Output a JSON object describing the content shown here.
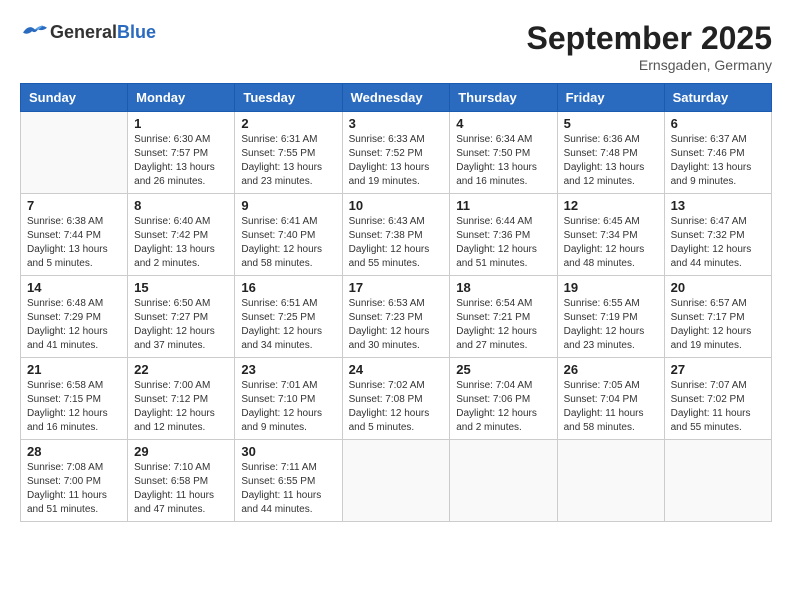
{
  "header": {
    "logo_general": "General",
    "logo_blue": "Blue",
    "month_title": "September 2025",
    "location": "Ernsgaden, Germany"
  },
  "weekdays": [
    "Sunday",
    "Monday",
    "Tuesday",
    "Wednesday",
    "Thursday",
    "Friday",
    "Saturday"
  ],
  "weeks": [
    [
      {
        "day": "",
        "info": ""
      },
      {
        "day": "1",
        "info": "Sunrise: 6:30 AM\nSunset: 7:57 PM\nDaylight: 13 hours\nand 26 minutes."
      },
      {
        "day": "2",
        "info": "Sunrise: 6:31 AM\nSunset: 7:55 PM\nDaylight: 13 hours\nand 23 minutes."
      },
      {
        "day": "3",
        "info": "Sunrise: 6:33 AM\nSunset: 7:52 PM\nDaylight: 13 hours\nand 19 minutes."
      },
      {
        "day": "4",
        "info": "Sunrise: 6:34 AM\nSunset: 7:50 PM\nDaylight: 13 hours\nand 16 minutes."
      },
      {
        "day": "5",
        "info": "Sunrise: 6:36 AM\nSunset: 7:48 PM\nDaylight: 13 hours\nand 12 minutes."
      },
      {
        "day": "6",
        "info": "Sunrise: 6:37 AM\nSunset: 7:46 PM\nDaylight: 13 hours\nand 9 minutes."
      }
    ],
    [
      {
        "day": "7",
        "info": "Sunrise: 6:38 AM\nSunset: 7:44 PM\nDaylight: 13 hours\nand 5 minutes."
      },
      {
        "day": "8",
        "info": "Sunrise: 6:40 AM\nSunset: 7:42 PM\nDaylight: 13 hours\nand 2 minutes."
      },
      {
        "day": "9",
        "info": "Sunrise: 6:41 AM\nSunset: 7:40 PM\nDaylight: 12 hours\nand 58 minutes."
      },
      {
        "day": "10",
        "info": "Sunrise: 6:43 AM\nSunset: 7:38 PM\nDaylight: 12 hours\nand 55 minutes."
      },
      {
        "day": "11",
        "info": "Sunrise: 6:44 AM\nSunset: 7:36 PM\nDaylight: 12 hours\nand 51 minutes."
      },
      {
        "day": "12",
        "info": "Sunrise: 6:45 AM\nSunset: 7:34 PM\nDaylight: 12 hours\nand 48 minutes."
      },
      {
        "day": "13",
        "info": "Sunrise: 6:47 AM\nSunset: 7:32 PM\nDaylight: 12 hours\nand 44 minutes."
      }
    ],
    [
      {
        "day": "14",
        "info": "Sunrise: 6:48 AM\nSunset: 7:29 PM\nDaylight: 12 hours\nand 41 minutes."
      },
      {
        "day": "15",
        "info": "Sunrise: 6:50 AM\nSunset: 7:27 PM\nDaylight: 12 hours\nand 37 minutes."
      },
      {
        "day": "16",
        "info": "Sunrise: 6:51 AM\nSunset: 7:25 PM\nDaylight: 12 hours\nand 34 minutes."
      },
      {
        "day": "17",
        "info": "Sunrise: 6:53 AM\nSunset: 7:23 PM\nDaylight: 12 hours\nand 30 minutes."
      },
      {
        "day": "18",
        "info": "Sunrise: 6:54 AM\nSunset: 7:21 PM\nDaylight: 12 hours\nand 27 minutes."
      },
      {
        "day": "19",
        "info": "Sunrise: 6:55 AM\nSunset: 7:19 PM\nDaylight: 12 hours\nand 23 minutes."
      },
      {
        "day": "20",
        "info": "Sunrise: 6:57 AM\nSunset: 7:17 PM\nDaylight: 12 hours\nand 19 minutes."
      }
    ],
    [
      {
        "day": "21",
        "info": "Sunrise: 6:58 AM\nSunset: 7:15 PM\nDaylight: 12 hours\nand 16 minutes."
      },
      {
        "day": "22",
        "info": "Sunrise: 7:00 AM\nSunset: 7:12 PM\nDaylight: 12 hours\nand 12 minutes."
      },
      {
        "day": "23",
        "info": "Sunrise: 7:01 AM\nSunset: 7:10 PM\nDaylight: 12 hours\nand 9 minutes."
      },
      {
        "day": "24",
        "info": "Sunrise: 7:02 AM\nSunset: 7:08 PM\nDaylight: 12 hours\nand 5 minutes."
      },
      {
        "day": "25",
        "info": "Sunrise: 7:04 AM\nSunset: 7:06 PM\nDaylight: 12 hours\nand 2 minutes."
      },
      {
        "day": "26",
        "info": "Sunrise: 7:05 AM\nSunset: 7:04 PM\nDaylight: 11 hours\nand 58 minutes."
      },
      {
        "day": "27",
        "info": "Sunrise: 7:07 AM\nSunset: 7:02 PM\nDaylight: 11 hours\nand 55 minutes."
      }
    ],
    [
      {
        "day": "28",
        "info": "Sunrise: 7:08 AM\nSunset: 7:00 PM\nDaylight: 11 hours\nand 51 minutes."
      },
      {
        "day": "29",
        "info": "Sunrise: 7:10 AM\nSunset: 6:58 PM\nDaylight: 11 hours\nand 47 minutes."
      },
      {
        "day": "30",
        "info": "Sunrise: 7:11 AM\nSunset: 6:55 PM\nDaylight: 11 hours\nand 44 minutes."
      },
      {
        "day": "",
        "info": ""
      },
      {
        "day": "",
        "info": ""
      },
      {
        "day": "",
        "info": ""
      },
      {
        "day": "",
        "info": ""
      }
    ]
  ]
}
